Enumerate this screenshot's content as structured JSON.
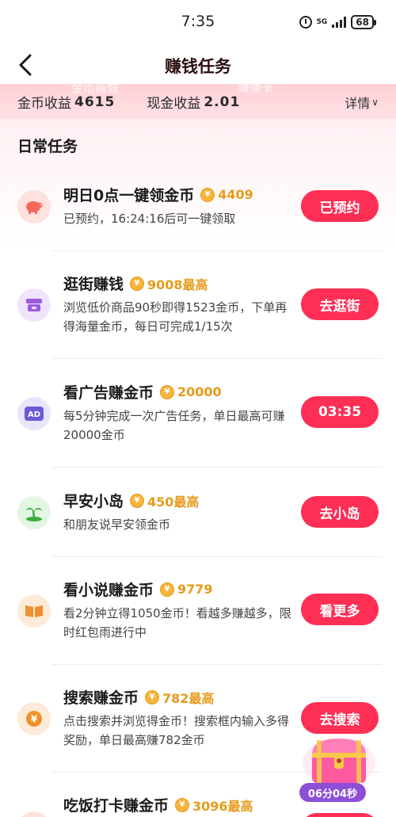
{
  "status_bar": {
    "time": "7:35",
    "network": "5G",
    "battery": "68"
  },
  "header": {
    "title": "赚钱任务"
  },
  "earnings": {
    "coin_label": "金币收益",
    "coin_value": "4615",
    "cash_label": "现金收益",
    "cash_value": "2.01",
    "details_label": "详情",
    "ghost_left": "金币商城",
    "ghost_right": "赚赚卡"
  },
  "section": {
    "title": "日常任务"
  },
  "tasks": [
    {
      "title": "明日0点一键领金币",
      "reward": "4409",
      "desc": "已预约，16:24:16后可一键领取",
      "button": "已预约",
      "icon": "piggy-bank-icon",
      "icon_bg": "#ffe1de",
      "icon_color": "#f26a5c"
    },
    {
      "title": "逛街赚钱",
      "reward": "9008最高",
      "desc": "浏览低价商品90秒即得1523金币，下单再得海量金币，每日可完成1/15次",
      "button": "去逛街",
      "icon": "store-icon",
      "icon_bg": "#efe4fb",
      "icon_color": "#9b5ce0"
    },
    {
      "title": "看广告赚金币",
      "reward": "20000",
      "desc": "每5分钟完成一次广告任务，单日最高可赚20000金币",
      "button": "03:35",
      "icon": "ad-icon",
      "icon_bg": "#e7e5fb",
      "icon_color": "#6b5bd6"
    },
    {
      "title": "早安小岛",
      "reward": "450最高",
      "desc": "和朋友说早安领金币",
      "button": "去小岛",
      "icon": "island-icon",
      "icon_bg": "#e3f6e2",
      "icon_color": "#3cab3b"
    },
    {
      "title": "看小说赚金币",
      "reward": "9779",
      "desc": "看2分钟立得1050金币！看越多赚越多，限时红包雨进行中",
      "button": "看更多",
      "icon": "book-icon",
      "icon_bg": "#fdebd8",
      "icon_color": "#f0902d"
    },
    {
      "title": "搜索赚金币",
      "reward": "782最高",
      "desc": "点击搜索并浏览得金币！搜索框内输入多得奖励，单日最高赚782金币",
      "button": "去搜索",
      "icon": "yen-coin-icon",
      "icon_bg": "#fdebd8",
      "icon_color": "#f0902d"
    },
    {
      "title": "吃饭打卡赚金币",
      "reward": "3096最高",
      "desc": "",
      "button": "",
      "icon": "meal-icon",
      "icon_bg": "#ffe1de",
      "icon_color": "#f26a5c"
    }
  ],
  "treasure_chest": {
    "timer": "06分04秒"
  },
  "colors": {
    "accent": "#ff2e55",
    "reward": "#e79a1b",
    "coin": "#f7b53b"
  }
}
